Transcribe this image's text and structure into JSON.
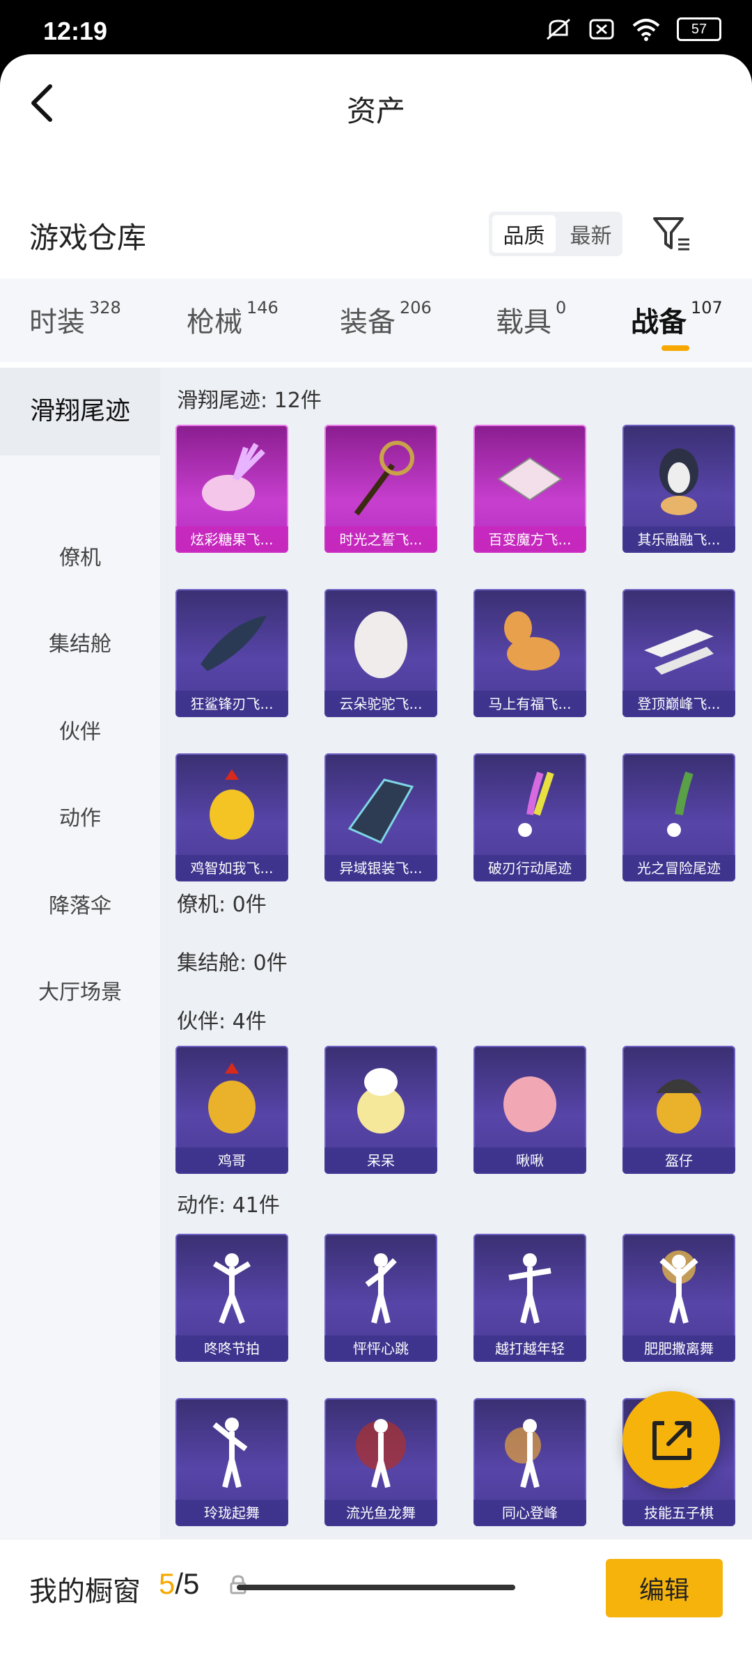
{
  "status": {
    "time": "12:19",
    "battery": "57"
  },
  "header": {
    "title": "资产"
  },
  "warehouse": {
    "title": "游戏仓库",
    "sort": [
      "品质",
      "最新"
    ]
  },
  "tabs": [
    {
      "label": "时装",
      "count": "328"
    },
    {
      "label": "枪械",
      "count": "146"
    },
    {
      "label": "装备",
      "count": "206"
    },
    {
      "label": "载具",
      "count": "0"
    },
    {
      "label": "战备",
      "count": "107"
    }
  ],
  "sidebar": [
    "滑翔尾迹",
    "僚机",
    "集结舱",
    "伙伴",
    "动作",
    "降落伞",
    "大厅场景"
  ],
  "sections": {
    "glide": "滑翔尾迹: 12件",
    "wingman": "僚机: 0件",
    "pod": "集结舱: 0件",
    "partner": "伙伴: 4件",
    "action": "动作: 41件"
  },
  "glide_items": [
    "炫彩糖果飞...",
    "时光之誓飞...",
    "百变魔方飞...",
    "其乐融融飞...",
    "狂鲨锋刃飞...",
    "云朵驼驼飞...",
    "马上有福飞...",
    "登顶巅峰飞...",
    "鸡智如我飞...",
    "异域银装飞...",
    "破刃行动尾迹",
    "光之冒险尾迹"
  ],
  "partner_items": [
    "鸡哥",
    "呆呆",
    "啾啾",
    "盔仔"
  ],
  "action_items": [
    "咚咚节拍",
    "怦怦心跳",
    "越打越年轻",
    "肥肥撒离舞",
    "玲珑起舞",
    "流光鱼龙舞",
    "同心登峰",
    "技能五子棋"
  ],
  "bottom": {
    "label": "我的橱窗",
    "count_current": "5",
    "count_total": "/5",
    "edit": "编辑"
  },
  "colors": {
    "accent": "#f6b30c",
    "card_purple": "#5745a8",
    "card_pink": "#c73fcf"
  }
}
